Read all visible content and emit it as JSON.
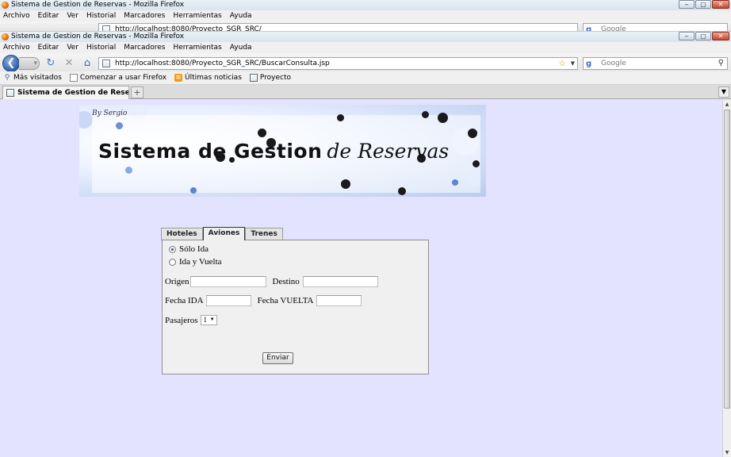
{
  "back_window": {
    "title": "Sistema de Gestion de Reservas - Mozilla Firefox",
    "menu": [
      "Archivo",
      "Editar",
      "Ver",
      "Historial",
      "Marcadores",
      "Herramientas",
      "Ayuda"
    ],
    "url": "http://localhost:8080/Proyecto_SGR_SRC/",
    "search_placeholder": "Google"
  },
  "window": {
    "title": "Sistema de Gestion de Reservas - Mozilla Firefox",
    "controls": {
      "minimize": "‒",
      "maximize": "▢",
      "close": "✕"
    }
  },
  "menu": [
    "Archivo",
    "Editar",
    "Ver",
    "Historial",
    "Marcadores",
    "Herramientas",
    "Ayuda"
  ],
  "navigation": {
    "back_icon": "back-arrow-icon",
    "url": "http://localhost:8080/Proyecto_SGR_SRC/BuscarConsulta.jsp",
    "search_placeholder": "Google"
  },
  "bookmarks": [
    {
      "label": "Más visitados",
      "icon": "most-visited-icon"
    },
    {
      "label": "Comenzar a usar Firefox",
      "icon": "page-icon"
    },
    {
      "label": "Últimas noticias",
      "icon": "rss-icon"
    },
    {
      "label": "Proyecto",
      "icon": "page-icon"
    }
  ],
  "tab": {
    "label": "Sistema de Gestion de Reservas",
    "new_tab": "+"
  },
  "banner": {
    "signature": "By Sergio",
    "title_bold": "Sistema de Gestion",
    "title_script": "de Reservas"
  },
  "form_tabs": [
    {
      "label": "Hoteles",
      "active": false
    },
    {
      "label": "Aviones",
      "active": true
    },
    {
      "label": "Trenes",
      "active": false
    }
  ],
  "form": {
    "trip_options": [
      {
        "label": "Sólo Ida",
        "selected": true
      },
      {
        "label": "Ida y Vuelta",
        "selected": false
      }
    ],
    "origen_label": "Origen",
    "origen_value": "",
    "destino_label": "Destino",
    "destino_value": "",
    "fecha_ida_label": "Fecha IDA",
    "fecha_ida_value": "",
    "fecha_vuelta_label": "Fecha VUELTA",
    "fecha_vuelta_value": "",
    "pasajeros_label": "Pasajeros",
    "pasajeros_value": "1",
    "submit_label": "Enviar"
  },
  "colors": {
    "page_background": "#e3e3ff",
    "panel_background": "#f0f0f0"
  }
}
